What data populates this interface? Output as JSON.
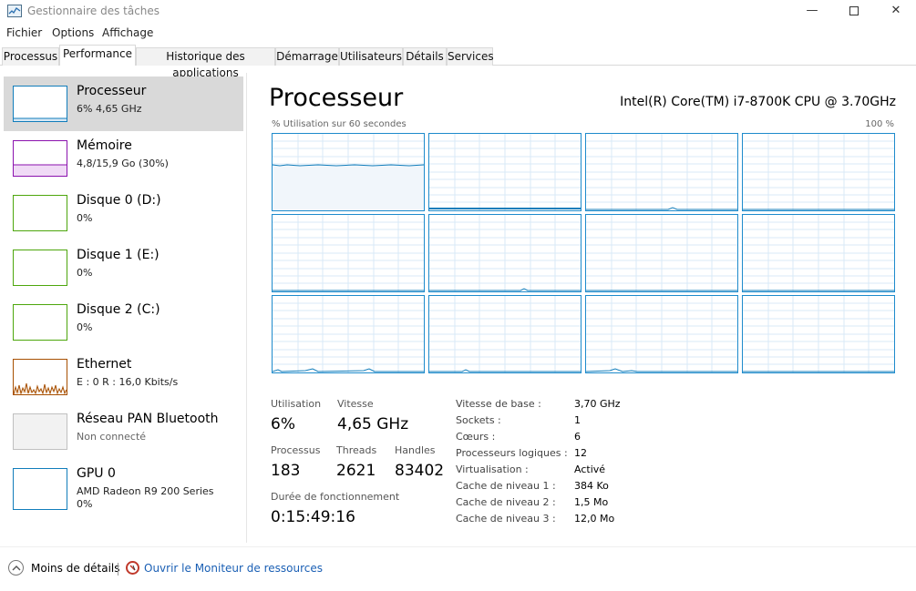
{
  "window": {
    "title": "Gestionnaire des tâches",
    "minimize": "—",
    "close": "✕"
  },
  "menu": [
    "Fichier",
    "Options",
    "Affichage"
  ],
  "tabs": [
    "Processus",
    "Performance",
    "Historique des applications",
    "Démarrage",
    "Utilisateurs",
    "Détails",
    "Services"
  ],
  "active_tab": "Performance",
  "sidebar": {
    "items": [
      {
        "title": "Processeur",
        "sub": "6% 4,65 GHz",
        "color": "#117dbb",
        "selected": true
      },
      {
        "title": "Mémoire",
        "sub": "4,8/15,9 Go (30%)",
        "color": "#8b12ae"
      },
      {
        "title": "Disque 0 (D:)",
        "sub": "0%",
        "color": "#4da60c"
      },
      {
        "title": "Disque 1 (E:)",
        "sub": "0%",
        "color": "#4da60c"
      },
      {
        "title": "Disque 2 (C:)",
        "sub": "0%",
        "color": "#4da60c"
      },
      {
        "title": "Ethernet",
        "sub": "E : 0 R : 16,0 Kbits/s",
        "color": "#a74f01"
      },
      {
        "title": "Réseau PAN Bluetooth",
        "sub": "Non connecté",
        "color": "#c0c0c0"
      },
      {
        "title": "GPU 0",
        "sub": "AMD Radeon R9 200 Series",
        "sub2": "0%",
        "color": "#117dbb"
      }
    ]
  },
  "main": {
    "title": "Processeur",
    "cpu_name": "Intel(R) Core(TM) i7-8700K CPU @ 3.70GHz",
    "graph_caption": "% Utilisation sur 60 secondes",
    "graph_max": "100 %",
    "core_count": 12,
    "accent": "#117dbb"
  },
  "stats": {
    "utilisation_label": "Utilisation",
    "utilisation": "6%",
    "vitesse_label": "Vitesse",
    "vitesse": "4,65 GHz",
    "processus_label": "Processus",
    "processus": "183",
    "threads_label": "Threads",
    "threads": "2621",
    "handles_label": "Handles",
    "handles": "83402",
    "uptime_label": "Durée de fonctionnement",
    "uptime": "0:15:49:16"
  },
  "specs": [
    {
      "label": "Vitesse de base :",
      "value": "3,70 GHz"
    },
    {
      "label": "Sockets :",
      "value": "1"
    },
    {
      "label": "Cœurs :",
      "value": "6"
    },
    {
      "label": "Processeurs logiques :",
      "value": "12"
    },
    {
      "label": "Virtualisation :",
      "value": "Activé"
    },
    {
      "label": "Cache de niveau 1 :",
      "value": "384 Ko"
    },
    {
      "label": "Cache de niveau 2 :",
      "value": "1,5 Mo"
    },
    {
      "label": "Cache de niveau 3 :",
      "value": "12,0 Mo"
    }
  ],
  "footer": {
    "less_details": "Moins de détails",
    "resource_monitor": "Ouvrir le Moniteur de ressources"
  }
}
